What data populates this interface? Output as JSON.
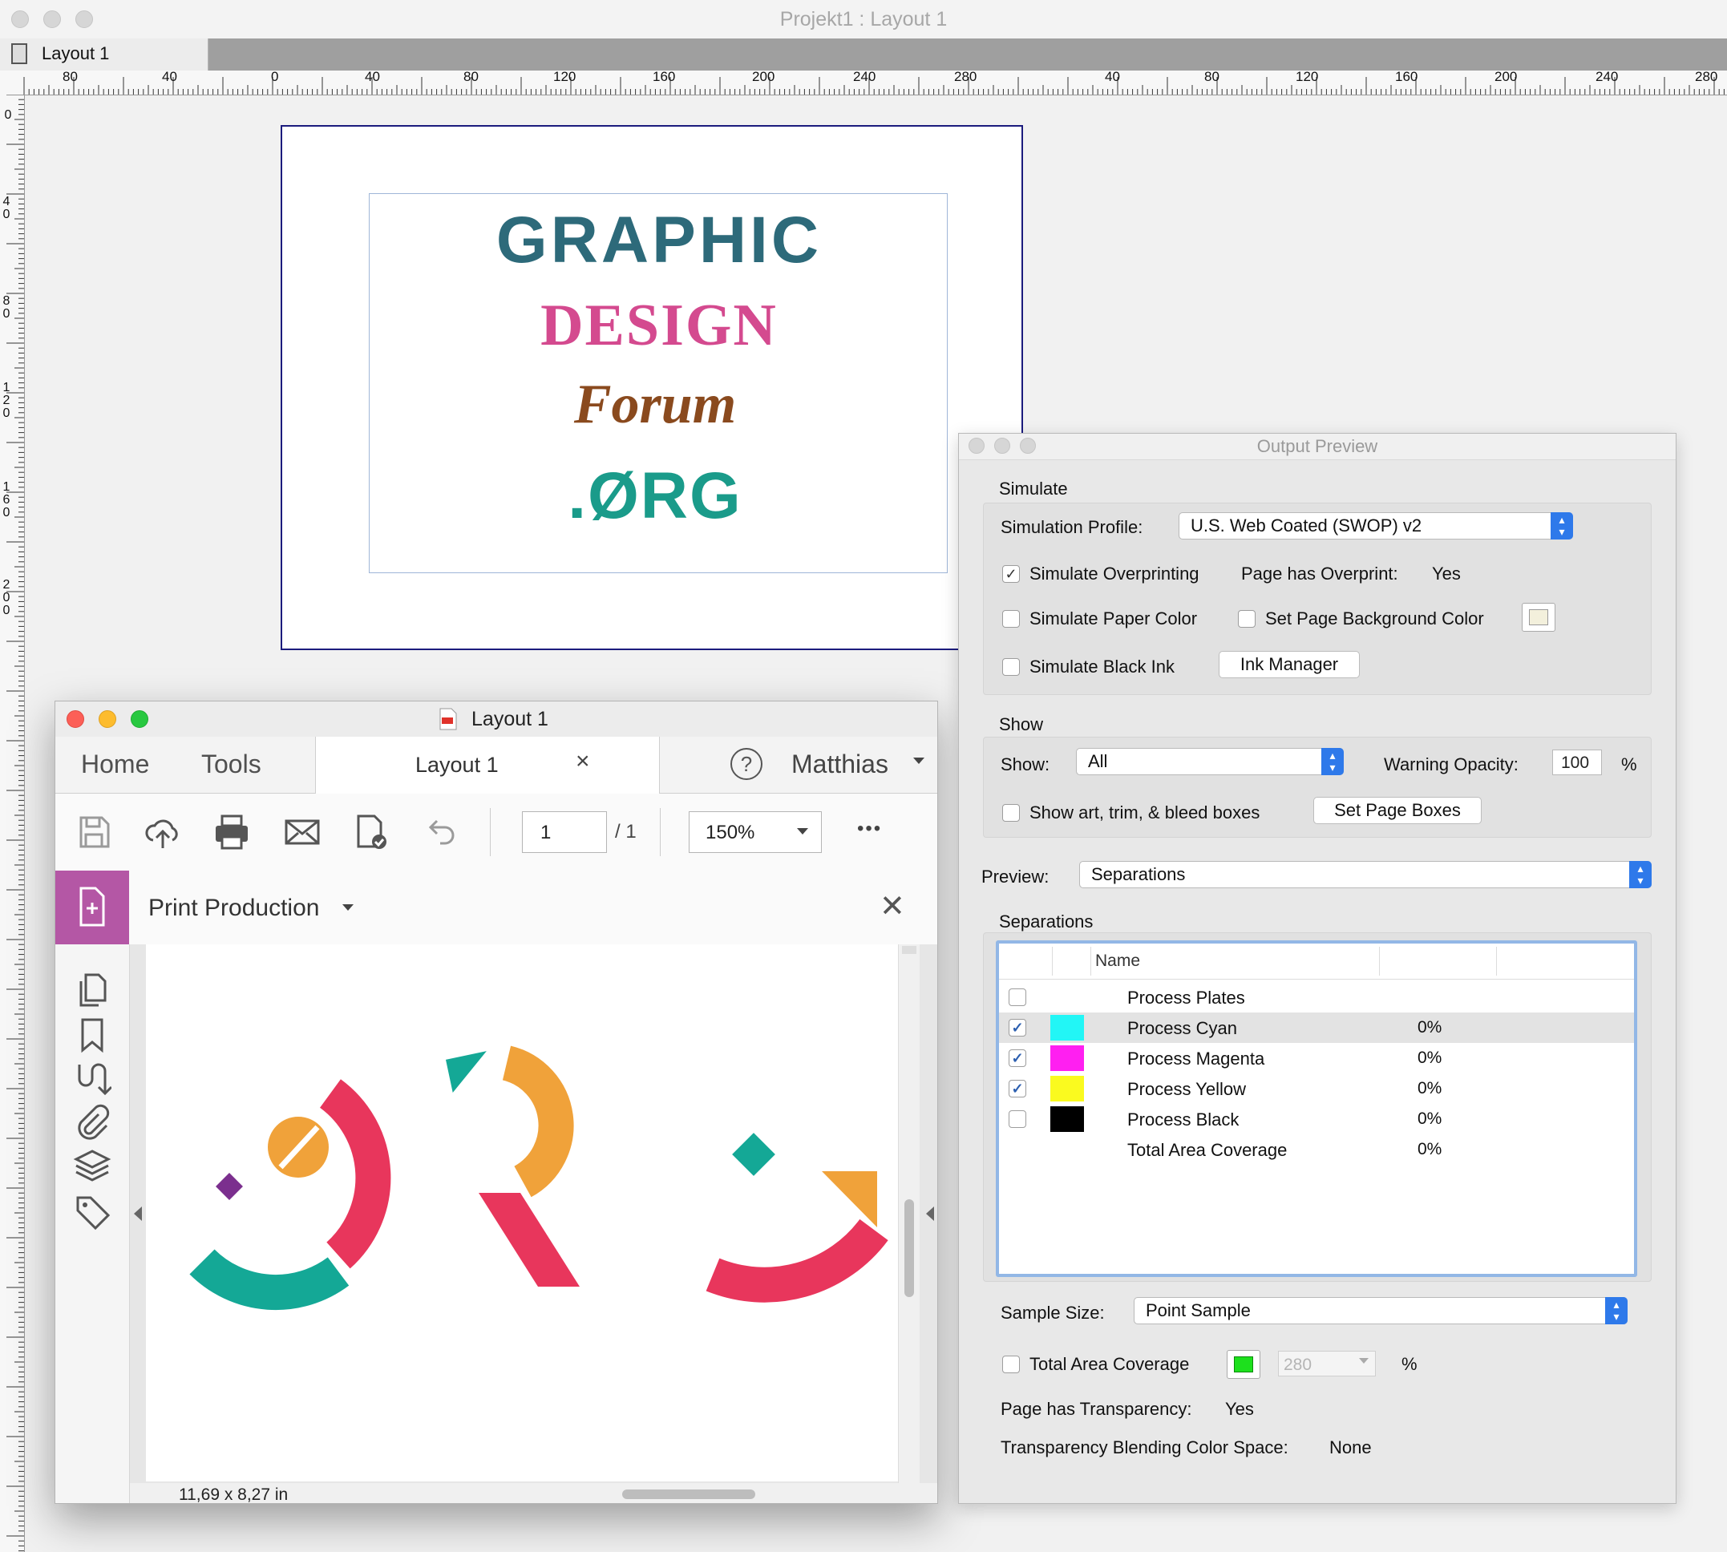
{
  "main_window": {
    "title": "Projekt1 : Layout 1",
    "tab_label": "Layout 1",
    "ruler_top_labels": [
      "80",
      "40",
      "0",
      "40",
      "80",
      "120",
      "160",
      "200",
      "240",
      "280",
      "40",
      "80",
      "120",
      "160",
      "200",
      "240",
      "280"
    ],
    "ruler_left_labels": [
      "0",
      "40",
      "80",
      "120",
      "160",
      "200"
    ]
  },
  "spread": {
    "logo_line1": "GRAPHIC",
    "logo_line2": "DESIGN",
    "logo_line3": "Forum",
    "logo_line4": ".ØRG"
  },
  "acrobat": {
    "title": "Layout 1",
    "nav": {
      "home": "Home",
      "tools": "Tools",
      "doc_tab": "Layout 1",
      "close_tab": "×",
      "help": "?",
      "user": "Matthias"
    },
    "toolbar": {
      "page_current": "1",
      "page_total": "/ 1",
      "zoom": "150%",
      "more": "•••"
    },
    "panel_title": "Print Production",
    "close_panel": "✕",
    "page_size": "11,69 x 8,27 in"
  },
  "output_preview": {
    "title": "Output Preview",
    "simulate": {
      "section_label": "Simulate",
      "profile_label": "Simulation Profile:",
      "profile_value": "U.S. Web Coated (SWOP) v2",
      "simulate_overprinting": "Simulate Overprinting",
      "simulate_overprinting_checked": true,
      "page_has_overprint_label": "Page has Overprint:",
      "page_has_overprint_value": "Yes",
      "simulate_paper_color": "Simulate Paper Color",
      "set_page_bg_color": "Set Page Background Color",
      "simulate_black_ink": "Simulate Black Ink",
      "ink_manager_button": "Ink Manager"
    },
    "show": {
      "section_label": "Show",
      "show_label": "Show:",
      "show_value": "All",
      "warning_opacity_label": "Warning Opacity:",
      "warning_opacity_value": "100",
      "percent": "%",
      "show_boxes": "Show art, trim, & bleed boxes",
      "set_page_boxes_button": "Set Page Boxes"
    },
    "preview_label": "Preview:",
    "preview_value": "Separations",
    "separations": {
      "section_label": "Separations",
      "column_name": "Name",
      "rows": [
        {
          "name": "Process Plates",
          "pct": "",
          "checked": false,
          "color": ""
        },
        {
          "name": "Process Cyan",
          "pct": "0%",
          "checked": true,
          "color": "#22f6f6"
        },
        {
          "name": "Process Magenta",
          "pct": "0%",
          "checked": true,
          "color": "#ff1ff1"
        },
        {
          "name": "Process Yellow",
          "pct": "0%",
          "checked": true,
          "color": "#fafa1f"
        },
        {
          "name": "Process Black",
          "pct": "0%",
          "checked": false,
          "color": "#000000"
        },
        {
          "name": "Total Area Coverage",
          "pct": "0%",
          "checked": null,
          "color": ""
        }
      ]
    },
    "sample_size_label": "Sample Size:",
    "sample_size_value": "Point Sample",
    "total_area_coverage_label": "Total Area Coverage",
    "total_area_coverage_value": "280",
    "total_area_percent": "%",
    "transparency_label": "Page has Transparency:",
    "transparency_value": "Yes",
    "blending_label": "Transparency Blending Color Space:",
    "blending_value": "None"
  },
  "colors": {
    "teal": "#14a896",
    "orange": "#f0a23a",
    "pink": "#e8365c",
    "purple": "#7b2f8e",
    "acrobat_purple": "#b457a5",
    "mac_red": "#fc5f57",
    "mac_yellow": "#fdbc2e",
    "mac_green": "#28c840",
    "coverage_green": "#1de01d"
  }
}
